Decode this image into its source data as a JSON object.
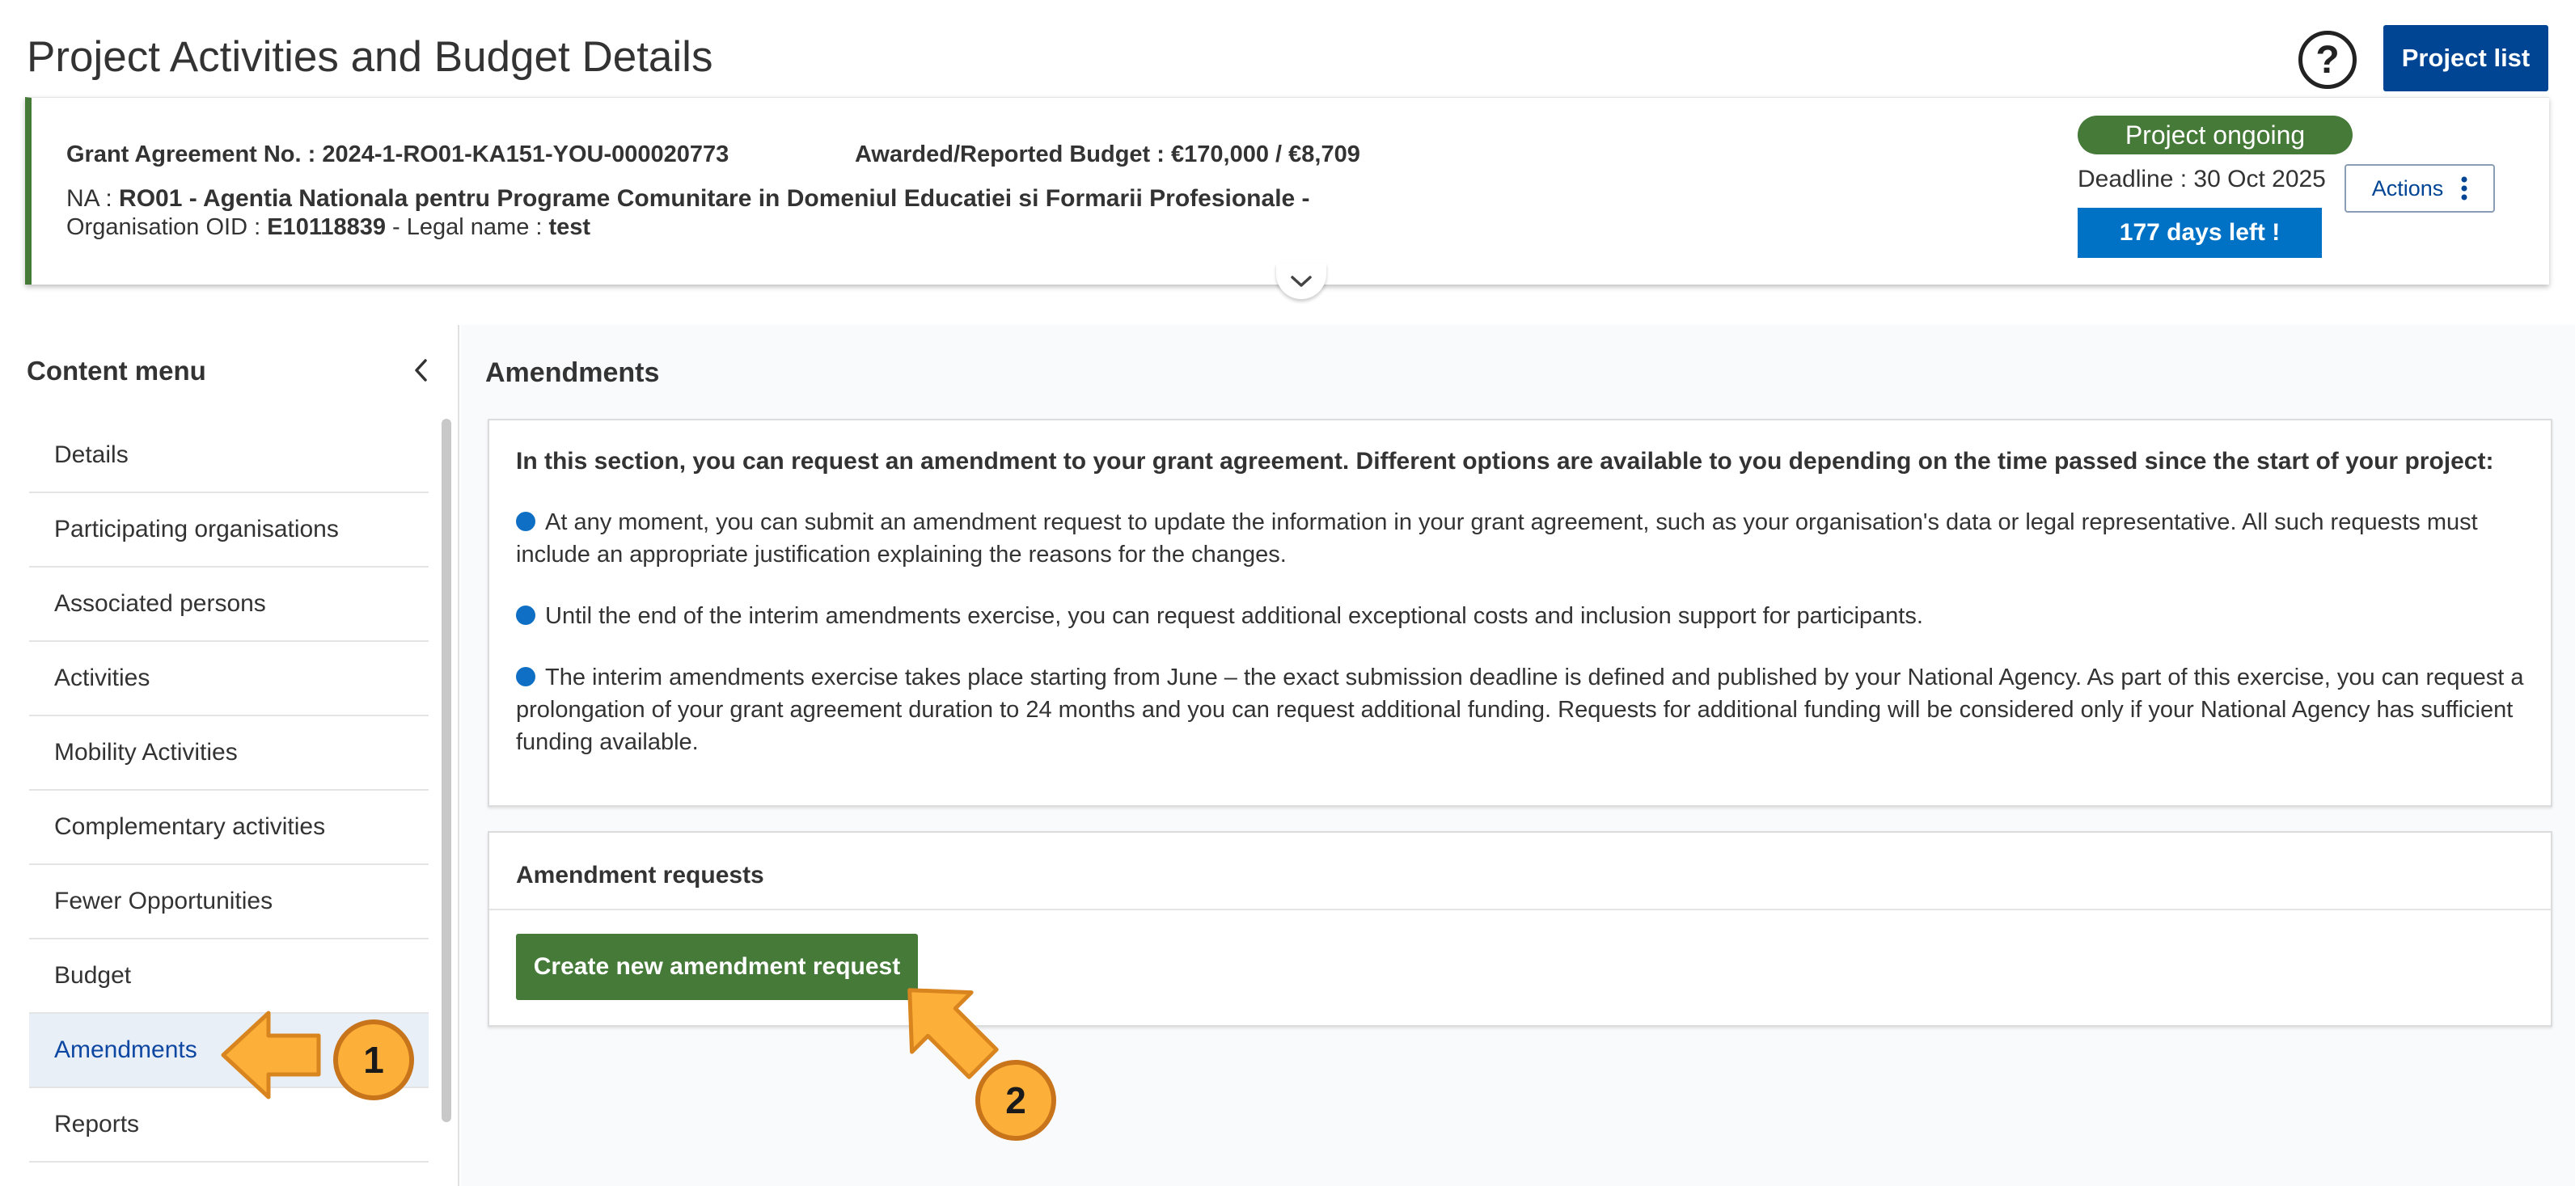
{
  "page": {
    "title": "Project Activities and Budget Details",
    "help_icon": "question-circle-icon",
    "help_glyph": "?",
    "project_list_label": "Project list"
  },
  "header": {
    "grant_label": "Grant Agreement No. : ",
    "grant_no": "2024-1-RO01-KA151-YOU-000020773",
    "budget_label": "Awarded/Reported Budget : ",
    "budget_value": "€170,000 / €8,709",
    "na_label": "NA : ",
    "na_value": "RO01 - Agentia Nationala pentru Programe Comunitare in Domeniul Educatiei si Formarii Profesionale -",
    "oid_label": "Organisation OID : ",
    "oid_value": "E10118839",
    "legal_label": " - Legal name : ",
    "legal_value": "test",
    "status": "Project ongoing",
    "deadline": "Deadline : 30 Oct 2025",
    "days_left": "177 days left !",
    "actions_label": "Actions",
    "colors": {
      "status": "#467a39",
      "days": "#0072c6",
      "primary": "#004494"
    }
  },
  "sidebar": {
    "title": "Content menu",
    "items": [
      {
        "label": "Details"
      },
      {
        "label": "Participating organisations"
      },
      {
        "label": "Associated persons"
      },
      {
        "label": "Activities"
      },
      {
        "label": "Mobility Activities"
      },
      {
        "label": "Complementary activities"
      },
      {
        "label": "Fewer Opportunities"
      },
      {
        "label": "Budget"
      },
      {
        "label": "Amendments",
        "active": true
      },
      {
        "label": "Reports"
      }
    ]
  },
  "main": {
    "section_title": "Amendments",
    "intro": "In this section, you can request an amendment to your grant agreement. Different options are available to you depending on the time passed since the start of your project:",
    "bullets": [
      "At any moment, you can submit an amendment request to update the information in your grant agreement, such as your organisation's data or legal representative. All such requests must include an appropriate justification explaining the reasons for the changes.",
      "Until the end of the interim amendments exercise, you can request additional exceptional costs and inclusion support for participants.",
      "The interim amendments exercise takes place starting from June – the exact submission deadline is defined and published by your National Agency. As part of this exercise, you can request a prolongation of your grant agreement duration to 24 months and you can request additional funding. Requests for additional funding will be considered only if your National Agency has sufficient funding available."
    ],
    "requests_title": "Amendment requests",
    "create_button": "Create new amendment request"
  },
  "annotations": [
    {
      "number": "1"
    },
    {
      "number": "2"
    }
  ]
}
